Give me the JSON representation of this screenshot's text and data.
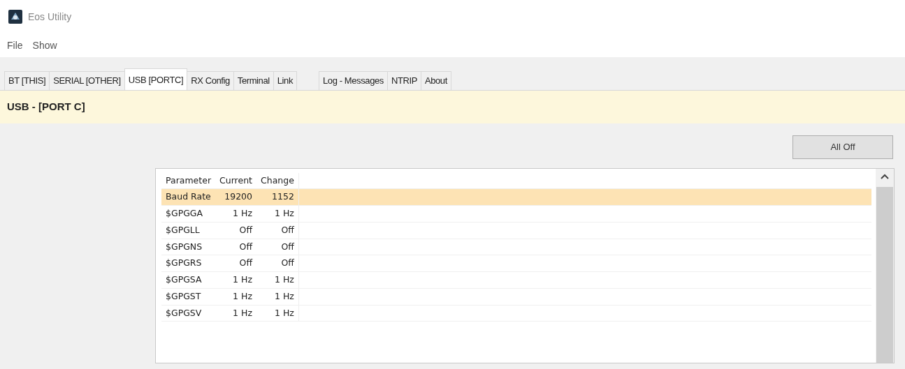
{
  "window": {
    "title": "Eos Utility"
  },
  "menu": [
    "File",
    "Show"
  ],
  "tabs": [
    {
      "label": "BT [THIS]",
      "selected": false
    },
    {
      "label": "SERIAL [OTHER]",
      "selected": false
    },
    {
      "label": "USB [PORTC]",
      "selected": true
    },
    {
      "label": "RX Config",
      "selected": false
    },
    {
      "label": "Terminal",
      "selected": false
    },
    {
      "label": "Link",
      "selected": false
    },
    {
      "label": "Log - Messages",
      "selected": false
    },
    {
      "label": "NTRIP",
      "selected": false
    },
    {
      "label": "About",
      "selected": false
    }
  ],
  "header": "USB - [PORT C]",
  "buttons": [
    "All Off"
  ],
  "table": {
    "columns": [
      "Parameter",
      "Current",
      "Change"
    ],
    "rows": [
      {
        "cells": [
          "Baud Rate",
          "19200",
          "1152"
        ],
        "selected": true
      },
      {
        "cells": [
          "$GPGGA",
          "1 Hz",
          "1 Hz"
        ],
        "selected": false
      },
      {
        "cells": [
          "$GPGLL",
          "Off",
          "Off"
        ],
        "selected": false
      },
      {
        "cells": [
          "$GPGNS",
          "Off",
          "Off"
        ],
        "selected": false
      },
      {
        "cells": [
          "$GPGRS",
          "Off",
          "Off"
        ],
        "selected": false
      },
      {
        "cells": [
          "$GPGSA",
          "1 Hz",
          "1 Hz"
        ],
        "selected": false
      },
      {
        "cells": [
          "$GPGST",
          "1 Hz",
          "1 Hz"
        ],
        "selected": false
      },
      {
        "cells": [
          "$GPGSV",
          "1 Hz",
          "1 Hz"
        ],
        "selected": false
      }
    ]
  }
}
